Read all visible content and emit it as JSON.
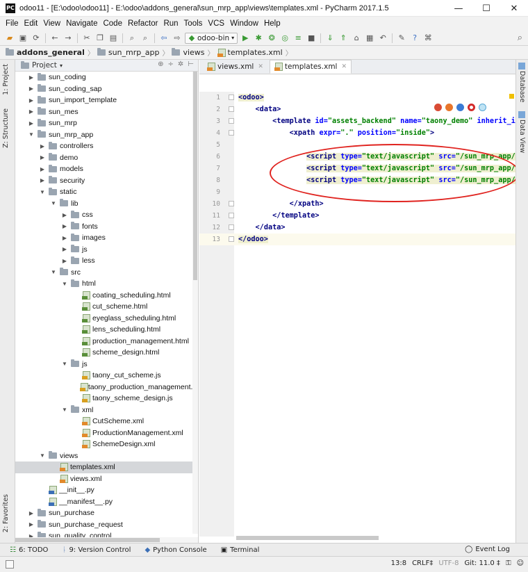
{
  "window": {
    "title": "odoo11 - [E:\\odoo\\odoo11] - E:\\odoo\\addons_general\\sun_mrp_app\\views\\templates.xml - PyCharm 2017.1.5",
    "logo_text": "PC",
    "minimize": "—",
    "maximize": "☐",
    "close": "✕"
  },
  "menu": [
    "File",
    "Edit",
    "View",
    "Navigate",
    "Code",
    "Refactor",
    "Run",
    "Tools",
    "VCS",
    "Window",
    "Help"
  ],
  "toolbar": {
    "run_config": "odoo-bin"
  },
  "breadcrumb": [
    "addons_general",
    "sun_mrp_app",
    "views",
    "templates.xml"
  ],
  "left_tabs": {
    "project": "1: Project",
    "structure": "Z: Structure",
    "favorites": "2: Favorites"
  },
  "right_tabs": {
    "database": "Database",
    "data_view": "Data View"
  },
  "project_panel": {
    "title": "Project",
    "tree": [
      {
        "label": "sun_coding",
        "depth": 0,
        "kind": "folder",
        "expanded": false
      },
      {
        "label": "sun_coding_sap",
        "depth": 0,
        "kind": "folder",
        "expanded": false
      },
      {
        "label": "sun_import_template",
        "depth": 0,
        "kind": "folder",
        "expanded": false
      },
      {
        "label": "sun_mes",
        "depth": 0,
        "kind": "folder",
        "expanded": false
      },
      {
        "label": "sun_mrp",
        "depth": 0,
        "kind": "folder",
        "expanded": false
      },
      {
        "label": "sun_mrp_app",
        "depth": 0,
        "kind": "folder",
        "expanded": true
      },
      {
        "label": "controllers",
        "depth": 1,
        "kind": "folder",
        "expanded": false
      },
      {
        "label": "demo",
        "depth": 1,
        "kind": "folder",
        "expanded": false
      },
      {
        "label": "models",
        "depth": 1,
        "kind": "folder",
        "expanded": false
      },
      {
        "label": "security",
        "depth": 1,
        "kind": "folder",
        "expanded": false
      },
      {
        "label": "static",
        "depth": 1,
        "kind": "folder",
        "expanded": true
      },
      {
        "label": "lib",
        "depth": 2,
        "kind": "folder",
        "expanded": true
      },
      {
        "label": "css",
        "depth": 3,
        "kind": "folder",
        "expanded": false
      },
      {
        "label": "fonts",
        "depth": 3,
        "kind": "folder",
        "expanded": false
      },
      {
        "label": "images",
        "depth": 3,
        "kind": "folder",
        "expanded": false
      },
      {
        "label": "js",
        "depth": 3,
        "kind": "folder",
        "expanded": false
      },
      {
        "label": "less",
        "depth": 3,
        "kind": "folder",
        "expanded": false
      },
      {
        "label": "src",
        "depth": 2,
        "kind": "folder",
        "expanded": true
      },
      {
        "label": "html",
        "depth": 3,
        "kind": "folder",
        "expanded": true
      },
      {
        "label": "coating_scheduling.html",
        "depth": 4,
        "kind": "html"
      },
      {
        "label": "cut_scheme.html",
        "depth": 4,
        "kind": "html"
      },
      {
        "label": "eyeglass_scheduling.html",
        "depth": 4,
        "kind": "html"
      },
      {
        "label": "lens_scheduling.html",
        "depth": 4,
        "kind": "html"
      },
      {
        "label": "production_management.html",
        "depth": 4,
        "kind": "html"
      },
      {
        "label": "scheme_design.html",
        "depth": 4,
        "kind": "html"
      },
      {
        "label": "js",
        "depth": 3,
        "kind": "folder",
        "expanded": true
      },
      {
        "label": "taony_cut_scheme.js",
        "depth": 4,
        "kind": "js"
      },
      {
        "label": "taony_production_management.js",
        "depth": 4,
        "kind": "js"
      },
      {
        "label": "taony_scheme_design.js",
        "depth": 4,
        "kind": "js"
      },
      {
        "label": "xml",
        "depth": 3,
        "kind": "folder",
        "expanded": true
      },
      {
        "label": "CutScheme.xml",
        "depth": 4,
        "kind": "xml"
      },
      {
        "label": "ProductionManagement.xml",
        "depth": 4,
        "kind": "xml"
      },
      {
        "label": "SchemeDesign.xml",
        "depth": 4,
        "kind": "xml"
      },
      {
        "label": "views",
        "depth": 1,
        "kind": "folder",
        "expanded": true
      },
      {
        "label": "templates.xml",
        "depth": 2,
        "kind": "xml",
        "selected": true
      },
      {
        "label": "views.xml",
        "depth": 2,
        "kind": "xml"
      },
      {
        "label": "__init__.py",
        "depth": 1,
        "kind": "py"
      },
      {
        "label": "__manifest__.py",
        "depth": 1,
        "kind": "py"
      },
      {
        "label": "sun_purchase",
        "depth": 0,
        "kind": "folder",
        "expanded": false
      },
      {
        "label": "sun_purchase_request",
        "depth": 0,
        "kind": "folder",
        "expanded": false
      },
      {
        "label": "sun_quality_control",
        "depth": 0,
        "kind": "folder",
        "expanded": false
      }
    ]
  },
  "editor": {
    "tabs": [
      {
        "label": "views.xml",
        "active": false
      },
      {
        "label": "templates.xml",
        "active": true
      }
    ],
    "lines": [
      {
        "n": "1",
        "html": "<span class='tag tagbg'>&lt;odoo&gt;</span>"
      },
      {
        "n": "2",
        "html": "    <span class='tag'>&lt;data&gt;</span>"
      },
      {
        "n": "3",
        "html": "        <span class='tag'>&lt;template </span><span class='attr'>id=</span><span class='val'>\"assets_backend\"</span> <span class='attr'>name=</span><span class='val'>\"taony_demo\"</span> <span class='attr'>inherit_i</span>"
      },
      {
        "n": "4",
        "html": "            <span class='tag'>&lt;xpath </span><span class='attr'>expr=</span><span class='val'>\".\"</span> <span class='attr'>position=</span><span class='val'>\"inside\"</span><span class='tag'>&gt;</span>"
      },
      {
        "n": "5",
        "html": ""
      },
      {
        "n": "6",
        "html": "                <span class='tagbg'><span class='tag'>&lt;script </span><span class='attr'>type=</span><span class='val'>\"text/javascript\"</span> <span class='attr'>src=</span><span class='val'>\"/sun_mrp_app/s</span></span>"
      },
      {
        "n": "7",
        "html": "                <span class='tagbg'><span class='tag'>&lt;script </span><span class='attr'>type=</span><span class='val'>\"text/javascript\"</span> <span class='attr'>src=</span><span class='val'>\"/sun_mrp_app/s</span></span>"
      },
      {
        "n": "8",
        "html": "                <span class='tagbg'><span class='tag'>&lt;script </span><span class='attr'>type=</span><span class='val'>\"text/javascript\"</span> <span class='attr'>src=</span><span class='val'>\"/sun_mrp_app/s</span></span>"
      },
      {
        "n": "9",
        "html": ""
      },
      {
        "n": "10",
        "html": "            <span class='tag'>&lt;/xpath&gt;</span>"
      },
      {
        "n": "11",
        "html": "        <span class='tag'>&lt;/template&gt;</span>"
      },
      {
        "n": "12",
        "html": "    <span class='tag'>&lt;/data&gt;</span>"
      },
      {
        "n": "13",
        "html": "<span class='tag tagbg'>&lt;/odoo&gt;</span>",
        "current": true
      }
    ]
  },
  "bottom_tools": [
    {
      "label": "6: TODO"
    },
    {
      "label": "9: Version Control"
    },
    {
      "label": "Python Console"
    },
    {
      "label": "Terminal"
    }
  ],
  "event_log": "Event Log",
  "status": {
    "position": "13:8",
    "line_sep": "CRLF‡",
    "encoding": "UTF-8",
    "git": "Git: 11.0 ‡"
  },
  "colors": {
    "highlight_ellipse": "#e0231f",
    "selection": "#d5d7da"
  }
}
